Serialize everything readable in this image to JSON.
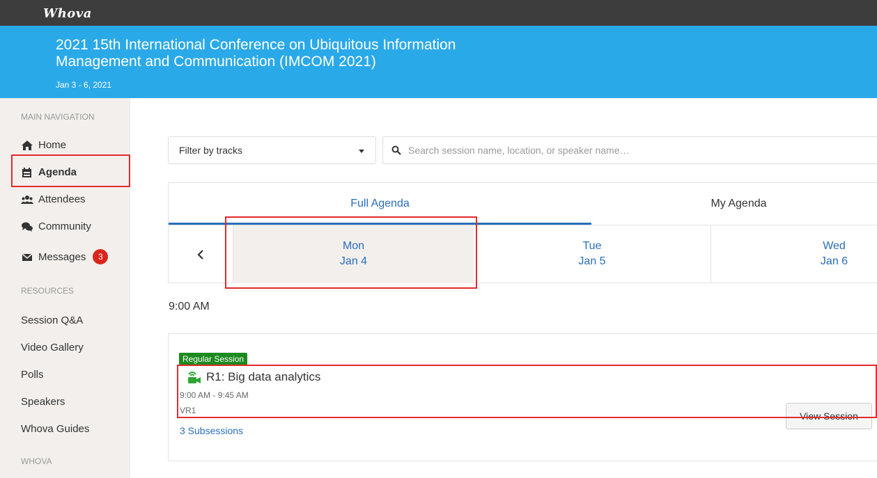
{
  "app": {
    "logo": "Whova"
  },
  "event": {
    "title": "2021 15th International Conference on Ubiquitous Information Management and Communication (IMCOM 2021)",
    "dates": "Jan 3 - 6, 2021"
  },
  "sidebar": {
    "main_heading": "MAIN NAVIGATION",
    "main_items": [
      {
        "label": "Home",
        "icon": "home-icon"
      },
      {
        "label": "Agenda",
        "icon": "calendar-icon",
        "active": true
      },
      {
        "label": "Attendees",
        "icon": "users-icon"
      },
      {
        "label": "Community",
        "icon": "comments-icon"
      },
      {
        "label": "Messages",
        "icon": "envelope-icon",
        "badge": "3"
      }
    ],
    "resources_heading": "RESOURCES",
    "resources_items": [
      "Session Q&A",
      "Video Gallery",
      "Polls",
      "Speakers",
      "Whova Guides"
    ],
    "whova_heading": "WHOVA"
  },
  "filters": {
    "track_select": "Filter by tracks",
    "search_placeholder": "Search session name, location, or speaker name…"
  },
  "tabs": {
    "full": "Full Agenda",
    "my": "My Agenda"
  },
  "days": [
    {
      "weekday": "Mon",
      "date": "Jan 4"
    },
    {
      "weekday": "Tue",
      "date": "Jan 5"
    },
    {
      "weekday": "Wed",
      "date": "Jan 6"
    }
  ],
  "agenda": {
    "time_slot": "9:00 AM",
    "session": {
      "tag": "Regular Session",
      "title": "R1: Big data analytics",
      "time": "9:00 AM - 9:45 AM",
      "location": "VR1",
      "subsessions": "3 Subsessions",
      "view_button": "View Session"
    }
  },
  "colors": {
    "banner": "#2aa9e8",
    "topbar": "#3d3d3d",
    "link": "#2a6ebb",
    "tag": "#1b8a1f",
    "highlight": "#e42a2a",
    "badge": "#d9261c"
  }
}
